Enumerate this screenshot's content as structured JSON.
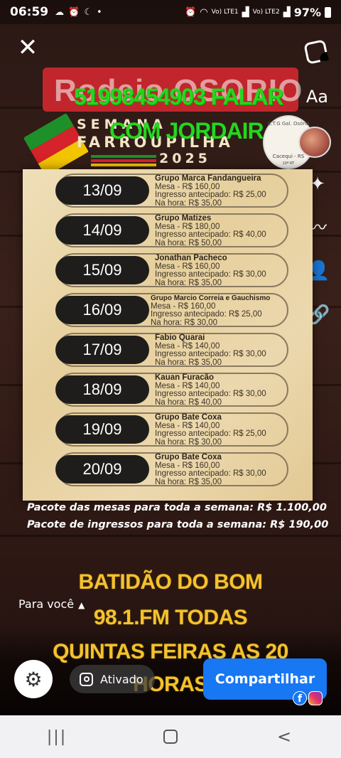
{
  "status_bar": {
    "time": "06:59",
    "carrier_1": "Vo) LTE1",
    "carrier_2": "Vo) LTE2",
    "battery": "97%"
  },
  "story": {
    "close_icon": "close-icon",
    "sticker_icon": "sticker-icon",
    "text_tool": "Aa",
    "overlay_text": {
      "phone": "51998454903 FALAR",
      "contact": "COM JORDAIR"
    },
    "side_tools": [
      "sparkle-icon",
      "scribble-icon",
      "add-person-icon",
      "link-icon"
    ],
    "for_you": "Para você"
  },
  "poster": {
    "title": "Rodeio OSORIO",
    "semana": "SEMANA",
    "event": "FARROUPILHA",
    "year": "2025",
    "logo": {
      "name": "C.T.G Gal. Osório",
      "city": "Cacequi - RS",
      "number": "10º RT"
    },
    "flag_colors": [
      "#1f8f2a",
      "#d6222a",
      "#f2c500"
    ],
    "events": [
      {
        "date": "13/09",
        "group": "Grupo Marca Fandangueira",
        "table": "Mesa - R$ 160,00",
        "presale": "Ingresso antecipado: R$ 25,00",
        "door": "Na hora: R$ 35,00"
      },
      {
        "date": "14/09",
        "group": "Grupo Matizes",
        "table": "Mesa - R$ 180,00",
        "presale": "Ingresso antecipado: R$ 40,00",
        "door": "Na hora: R$ 50,00"
      },
      {
        "date": "15/09",
        "group": "Jonathan Pacheco",
        "table": "Mesa - R$ 160,00",
        "presale": "Ingresso antecipado: R$ 30,00",
        "door": "Na hora: R$ 35,00"
      },
      {
        "date": "16/09",
        "group": "Grupo Marcio Correia e Gauchismo",
        "table": "Mesa - R$ 160,00",
        "presale": "Ingresso antecipado: R$ 25,00",
        "door": "Na hora: R$ 30,00"
      },
      {
        "date": "17/09",
        "group": "Fabio Quarai",
        "table": "Mesa - R$ 140,00",
        "presale": "Ingresso antecipado: R$ 30,00",
        "door": "Na hora: R$ 35,00"
      },
      {
        "date": "18/09",
        "group": "Kauan Furacão",
        "table": "Mesa - R$ 140,00",
        "presale": "Ingresso antecipado: R$ 30,00",
        "door": "Na hora: R$ 40,00"
      },
      {
        "date": "19/09",
        "group": "Grupo Bate Coxa",
        "table": "Mesa - R$ 140,00",
        "presale": "Ingresso antecipado: R$ 25,00",
        "door": "Na hora: R$ 30,00"
      },
      {
        "date": "20/09",
        "group": "Grupo Bate Coxa",
        "table": "Mesa - R$ 160,00",
        "presale": "Ingresso antecipado: R$ 30,00",
        "door": "Na hora: R$ 35,00"
      }
    ],
    "package_tables": "Pacote das mesas para toda a semana: R$ 1.100,00",
    "package_tickets": "Pacote de ingressos para toda a semana: R$ 190,00"
  },
  "promo": {
    "line1": "BATIDÃO DO BOM",
    "line2": "98.1.FM TODAS",
    "line3": "QUINTAS FEIRAS AS 20",
    "line4": "HORAS"
  },
  "bottom": {
    "settings_icon": "gear-icon",
    "instagram_toggle": "Ativado",
    "share_label": "Compartilhar",
    "fb_letter": "f"
  },
  "navbar": {
    "recent": "|||",
    "back": "<"
  }
}
